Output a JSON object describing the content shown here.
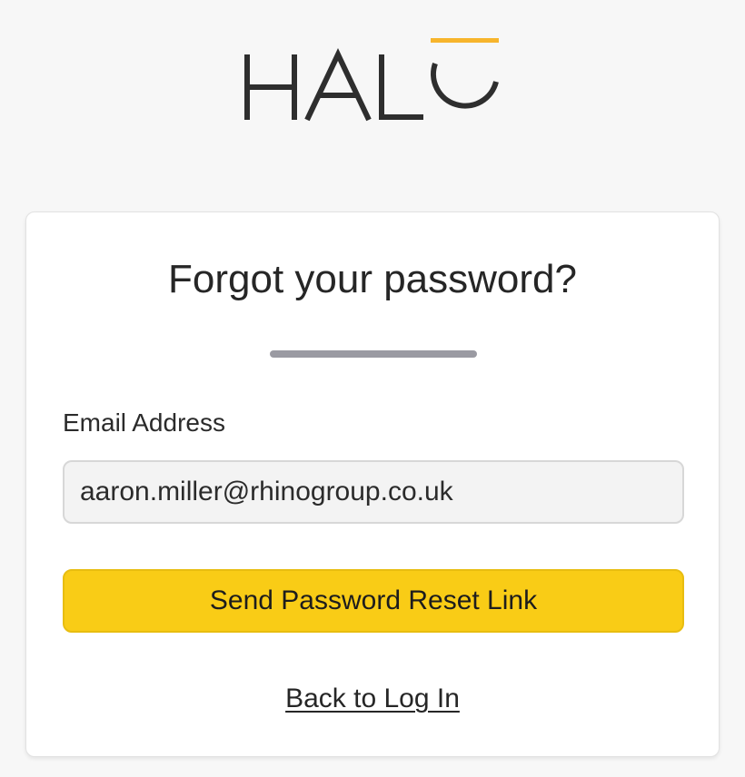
{
  "brand": {
    "logo_text": "HALO",
    "accent_color": "#f7b52c",
    "logo_color": "#2e2e2e"
  },
  "card": {
    "title": "Forgot your password?",
    "email": {
      "label": "Email Address",
      "value": "aaron.miller@rhinogroup.co.uk"
    },
    "send_button_label": "Send Password Reset Link",
    "back_link_label": "Back to Log In"
  },
  "colors": {
    "button": "#f9cc16",
    "divider": "#9a9aa2",
    "background": "#f7f7f7"
  }
}
